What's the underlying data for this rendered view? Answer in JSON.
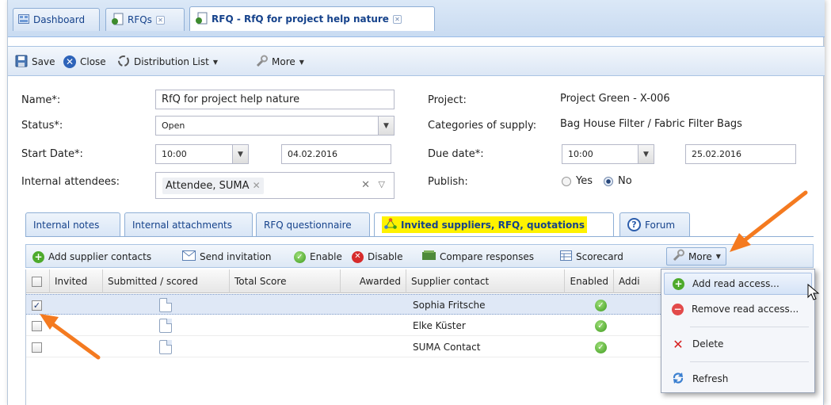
{
  "tabs": [
    {
      "label": "Dashboard"
    },
    {
      "label": "RFQs"
    },
    {
      "label": "RFQ - RfQ for project help nature"
    }
  ],
  "toolbar": {
    "save": "Save",
    "close": "Close",
    "distribution_list": "Distribution List",
    "more": "More"
  },
  "form": {
    "name_label": "Name*:",
    "name_value": "RfQ for project help nature",
    "status_label": "Status*:",
    "status_value": "Open",
    "start_label": "Start Date*:",
    "start_time": "10:00",
    "start_date": "04.02.2016",
    "attendees_label": "Internal attendees:",
    "attendee_chip": "Attendee, SUMA",
    "project_label": "Project:",
    "project_value": "Project Green - X-006",
    "categories_label": "Categories of supply:",
    "categories_value": "Bag House Filter / Fabric Filter Bags",
    "due_label": "Due date*:",
    "due_time": "10:00",
    "due_date": "25.02.2016",
    "publish_label": "Publish:",
    "publish_yes": "Yes",
    "publish_no": "No",
    "publish_selected": "No"
  },
  "inner_tabs": [
    {
      "label": "Internal notes"
    },
    {
      "label": "Internal attachments"
    },
    {
      "label": "RFQ questionnaire"
    },
    {
      "label": "Invited suppliers, RFQ, quotations"
    },
    {
      "label": "Forum"
    }
  ],
  "grid_toolbar": {
    "add_contacts": "Add supplier contacts",
    "send_invitation": "Send invitation",
    "enable": "Enable",
    "disable": "Disable",
    "compare": "Compare responses",
    "scorecard": "Scorecard",
    "more": "More"
  },
  "grid": {
    "columns": [
      "Invited",
      "Submitted / scored",
      "Total Score",
      "Awarded",
      "Supplier contact",
      "Enabled",
      "Addi"
    ],
    "rows": [
      {
        "contact": "Sophia Fritsche",
        "checked": true,
        "enabled": true
      },
      {
        "contact": "Elke Küster",
        "checked": false,
        "enabled": true
      },
      {
        "contact": "SUMA Contact",
        "checked": false,
        "enabled": true
      }
    ]
  },
  "menu": {
    "items": [
      {
        "label": "Add read access..."
      },
      {
        "label": "Remove read access..."
      },
      {
        "label": "Delete"
      },
      {
        "label": "Refresh"
      }
    ]
  },
  "colors": {
    "accent_blue": "#15428b",
    "highlight": "#fff200",
    "arrow": "#f47a20"
  }
}
